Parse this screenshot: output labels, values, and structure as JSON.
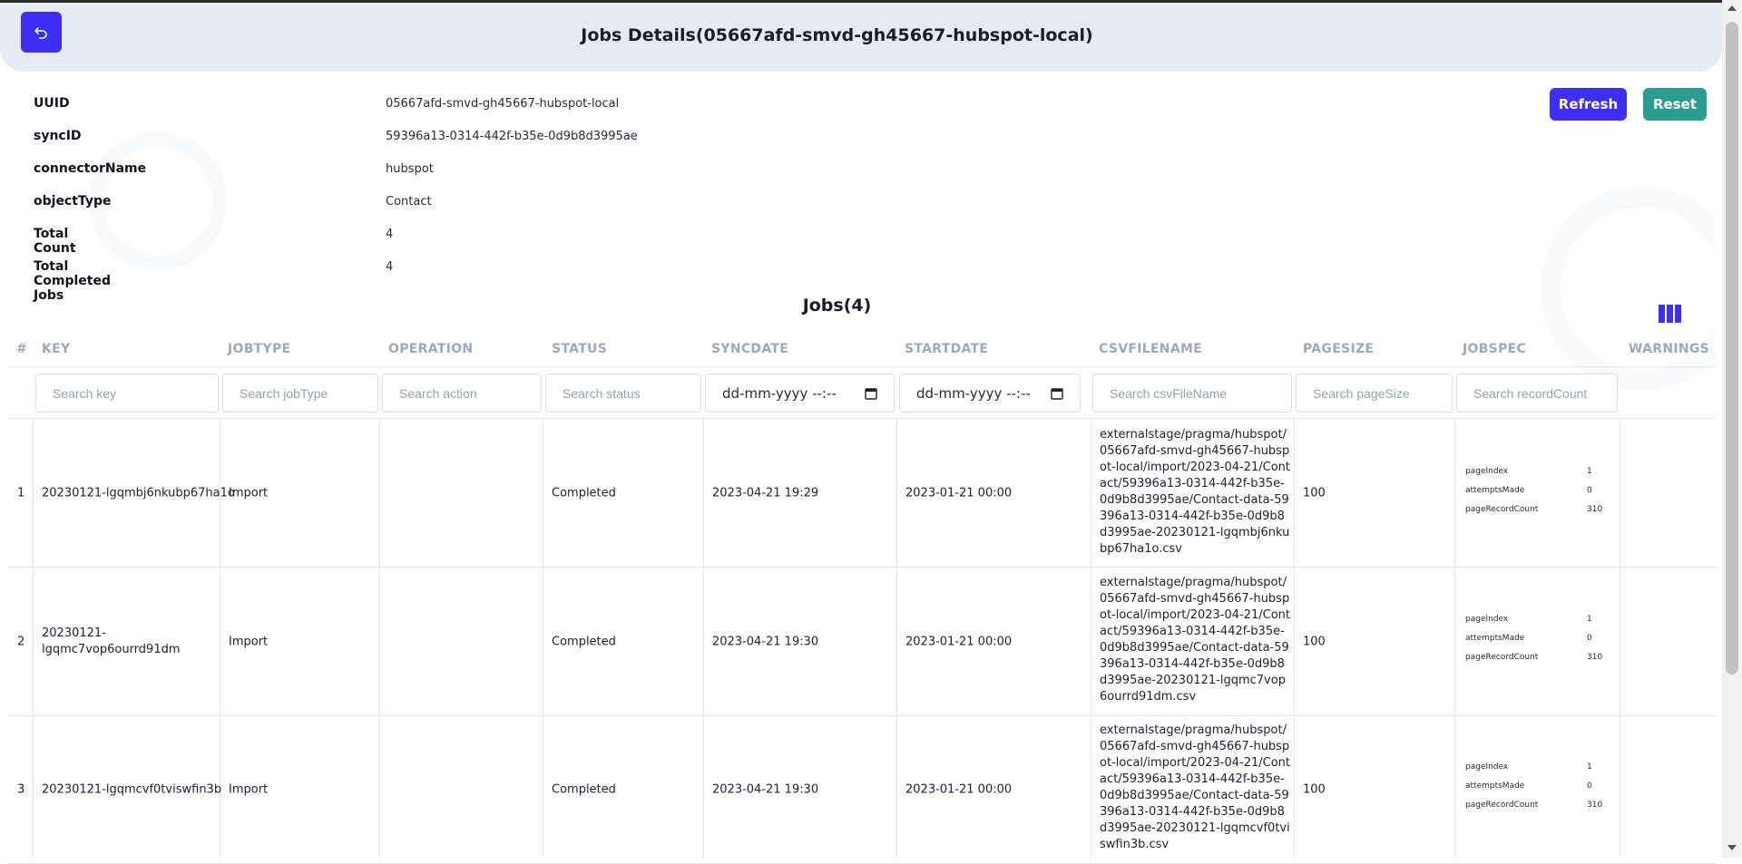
{
  "header": {
    "title": "Jobs Details(05667afd-smvd-gh45667-hubspot-local)"
  },
  "info": [
    {
      "label": "UUID",
      "value": "05667afd-smvd-gh45667-hubspot-local"
    },
    {
      "label": "syncID",
      "value": "59396a13-0314-442f-b35e-0d9b8d3995ae"
    },
    {
      "label": "connectorName",
      "value": "hubspot"
    },
    {
      "label": "objectType",
      "value": "Contact"
    },
    {
      "label": "Total Count",
      "value": "4"
    },
    {
      "label": "Total Completed Jobs",
      "value": "4"
    }
  ],
  "actions": {
    "refresh_label": "Refresh",
    "reset_label": "Reset"
  },
  "jobs": {
    "title": "Jobs(4)",
    "columns": [
      "#",
      "KEY",
      "JOBTYPE",
      "OPERATION",
      "STATUS",
      "SYNCDATE",
      "STARTDATE",
      "CSVFILENAME",
      "PAGESIZE",
      "JOBSPEC",
      "WARNINGS"
    ],
    "filters": {
      "key": "Search key",
      "jobType": "Search jobType",
      "action": "Search action",
      "status": "Search status",
      "syncdate": "dd-mm-yyyy --:--",
      "startdate": "dd-mm-yyyy --:--",
      "csvFileName": "Search csvFileName",
      "pageSize": "Search pageSize",
      "recordCount": "Search recordCount"
    },
    "spec_keys": {
      "pageIndex": "pageIndex",
      "attemptsMade": "attemptsMade",
      "pageRecordCount": "pageRecordCount"
    },
    "rows": [
      {
        "index": "1",
        "key": "20230121-lgqmbj6nkubp67ha1o",
        "jobtype": "Import",
        "operation": "",
        "status": "Completed",
        "syncdate": "2023-04-21 19:29",
        "startdate": "2023-01-21 00:00",
        "csv": "externalstage/pragma/hubspot/05667afd-smvd-gh45667-hubspot-local/import/2023-04-21/Contact/59396a13-0314-442f-b35e-0d9b8d3995ae/Contact-data-59396a13-0314-442f-b35e-0d9b8d3995ae-20230121-lgqmbj6nkubp67ha1o.csv",
        "pagesize": "100",
        "pageIndex": "1",
        "attemptsMade": "0",
        "pageRecordCount": "310"
      },
      {
        "index": "2",
        "key": "20230121-lgqmc7vop6ourrd91dm",
        "jobtype": "Import",
        "operation": "",
        "status": "Completed",
        "syncdate": "2023-04-21 19:30",
        "startdate": "2023-01-21 00:00",
        "csv": "externalstage/pragma/hubspot/05667afd-smvd-gh45667-hubspot-local/import/2023-04-21/Contact/59396a13-0314-442f-b35e-0d9b8d3995ae/Contact-data-59396a13-0314-442f-b35e-0d9b8d3995ae-20230121-lgqmc7vop6ourrd91dm.csv",
        "pagesize": "100",
        "pageIndex": "1",
        "attemptsMade": "0",
        "pageRecordCount": "310"
      },
      {
        "index": "3",
        "key": "20230121-lgqmcvf0tviswfin3b",
        "jobtype": "Import",
        "operation": "",
        "status": "Completed",
        "syncdate": "2023-04-21 19:30",
        "startdate": "2023-01-21 00:00",
        "csv": "externalstage/pragma/hubspot/05667afd-smvd-gh45667-hubspot-local/import/2023-04-21/Contact/59396a13-0314-442f-b35e-0d9b8d3995ae/Contact-data-59396a13-0314-442f-b35e-0d9b8d3995ae-20230121-lgqmcvf0tviswfin3b.csv",
        "pagesize": "100",
        "pageIndex": "1",
        "attemptsMade": "0",
        "pageRecordCount": "310"
      }
    ]
  },
  "icons": {
    "back": "back-arrow-icon",
    "columns": "columns-icon",
    "calendar": "calendar-icon"
  },
  "colors": {
    "primary": "#3f2ef6",
    "secondary": "#2a9d8f",
    "header_bg": "#e6ebf3"
  }
}
